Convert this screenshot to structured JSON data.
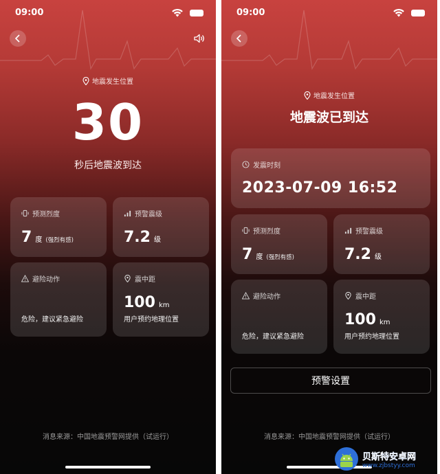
{
  "status": {
    "time": "09:00"
  },
  "left": {
    "location": "地震发生位置",
    "countdown": "30",
    "countdown_caption": "秒后地震波到达",
    "intensity": {
      "label": "预测烈度",
      "value": "7",
      "unit": "度",
      "note": "(强烈有感)"
    },
    "magnitude": {
      "label": "预警震级",
      "value": "7.2",
      "unit": "级"
    },
    "action": {
      "label": "避险动作",
      "text": "危险，建议紧急避险"
    },
    "distance": {
      "label": "震中距",
      "value": "100",
      "unit": "km",
      "note": "用户预约地理位置"
    },
    "source": "消息来源：中国地震预警网提供（试运行）"
  },
  "right": {
    "location": "地震发生位置",
    "title": "地震波已到达",
    "time_label": "发震时刻",
    "time_value": "2023-07-09 16:52",
    "intensity": {
      "label": "预测烈度",
      "value": "7",
      "unit": "度",
      "note": "(强烈有感)"
    },
    "magnitude": {
      "label": "预警震级",
      "value": "7.2",
      "unit": "级"
    },
    "action": {
      "label": "避险动作",
      "text": "危险，建议紧急避险"
    },
    "distance": {
      "label": "震中距",
      "value": "100",
      "unit": "km",
      "note": "用户预约地理位置"
    },
    "settings_button": "预警设置",
    "source": "消息来源：中国地震预警网提供（试运行）"
  },
  "watermark": {
    "title": "贝斯特安卓网",
    "url": "www.zjbstyy.com"
  },
  "colors": {
    "accent_red": "#c8423f",
    "card_bg": "rgba(255,255,255,0.13)",
    "watermark_blue": "#2e6fd8"
  }
}
